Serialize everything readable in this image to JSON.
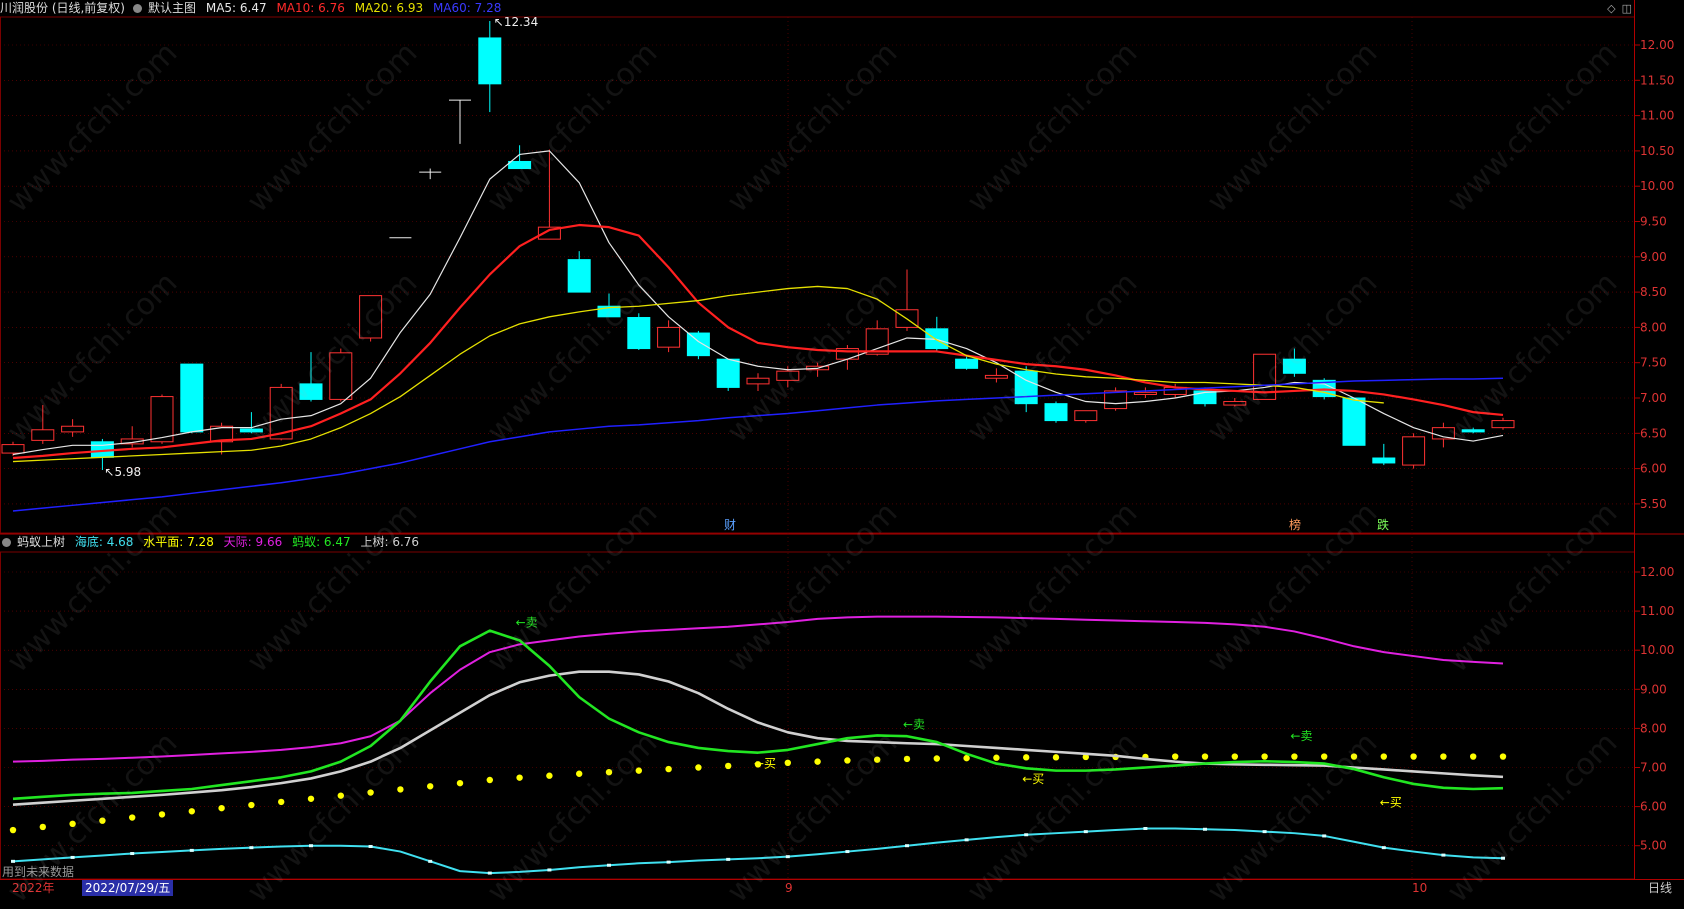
{
  "top_pane": {
    "stock": "川润股份 (日线,前复权)",
    "preset": "默认主图",
    "ma5": "MA5: 6.47",
    "ma10": "MA10: 6.76",
    "ma20": "MA20: 6.93",
    "ma60": "MA60: 7.28",
    "high_label": "12.34",
    "low_label": "5.98",
    "events": [
      "财",
      "榜",
      "跌"
    ],
    "y_ticks": [
      "12.00",
      "11.50",
      "11.00",
      "10.50",
      "10.00",
      "9.50",
      "9.00",
      "8.50",
      "8.00",
      "7.50",
      "7.00",
      "6.50",
      "6.00",
      "5.50"
    ]
  },
  "bottom_pane": {
    "indicator": "蚂蚁上树",
    "haidi": "海底: 4.68",
    "shuiping": "水平面: 7.28",
    "tianji": "天际: 9.66",
    "mayi": "蚂蚁: 6.47",
    "shangshu": "上树: 6.76",
    "signals": [
      "←卖",
      "←卖",
      "←卖",
      "←买",
      "←买",
      "←买"
    ],
    "y_ticks": [
      "12.00",
      "11.00",
      "10.00",
      "9.00",
      "8.00",
      "7.00",
      "6.00",
      "5.00"
    ],
    "note": "用到未来数据"
  },
  "footer": {
    "year": "2022年",
    "date": "2022/07/29/五",
    "m9": "9",
    "m10": "10",
    "period": "日线"
  },
  "watermark": "www.cfchi.com",
  "colors": {
    "up": "#ff3232",
    "down": "#00ffff",
    "ma5": "#e6e6e6",
    "ma10": "#ff2020",
    "ma20": "#e5e000",
    "ma60": "#2020ff",
    "haidi": "#40e0f0",
    "shuiping": "#ffff00",
    "tianji": "#e020e0",
    "mayi": "#22e622",
    "shangshu": "#d0d0d0",
    "grid": "#7a0000"
  },
  "chart_data": [
    {
      "type": "candlestick",
      "title": "川润股份 (日线,前复权)",
      "candles": [
        {
          "o": 6.22,
          "c": 6.34,
          "h": 6.38,
          "l": 6.18
        },
        {
          "o": 6.4,
          "c": 6.55,
          "h": 6.9,
          "l": 6.35
        },
        {
          "o": 6.52,
          "c": 6.6,
          "h": 6.7,
          "l": 6.45
        },
        {
          "o": 6.38,
          "c": 6.16,
          "h": 6.42,
          "l": 5.98
        },
        {
          "o": 6.35,
          "c": 6.42,
          "h": 6.6,
          "l": 6.3
        },
        {
          "o": 6.38,
          "c": 7.02,
          "h": 7.05,
          "l": 6.35
        },
        {
          "o": 7.48,
          "c": 6.52,
          "h": 7.48,
          "l": 6.5
        },
        {
          "o": 6.38,
          "c": 6.6,
          "h": 6.65,
          "l": 6.2
        },
        {
          "o": 6.56,
          "c": 6.52,
          "h": 6.8,
          "l": 6.5
        },
        {
          "o": 6.42,
          "c": 7.15,
          "h": 7.2,
          "l": 6.4
        },
        {
          "o": 7.2,
          "c": 6.98,
          "h": 7.65,
          "l": 6.95
        },
        {
          "o": 6.98,
          "c": 7.64,
          "h": 7.7,
          "l": 6.95
        },
        {
          "o": 7.85,
          "c": 8.45,
          "h": 8.45,
          "l": 7.8
        },
        {
          "o": 9.27,
          "c": 9.27,
          "h": 9.27,
          "l": 9.27
        },
        {
          "o": 10.2,
          "c": 10.2,
          "h": 10.25,
          "l": 10.1
        },
        {
          "o": 11.22,
          "c": 11.22,
          "h": 11.22,
          "l": 10.6
        },
        {
          "o": 12.1,
          "c": 11.45,
          "h": 12.34,
          "l": 11.05
        },
        {
          "o": 10.35,
          "c": 10.25,
          "h": 10.58,
          "l": 10.25
        },
        {
          "o": 9.25,
          "c": 9.42,
          "h": 10.52,
          "l": 9.25
        },
        {
          "o": 8.96,
          "c": 8.5,
          "h": 9.08,
          "l": 8.5
        },
        {
          "o": 8.3,
          "c": 8.15,
          "h": 8.48,
          "l": 8.15
        },
        {
          "o": 8.14,
          "c": 7.7,
          "h": 8.2,
          "l": 7.68
        },
        {
          "o": 7.72,
          "c": 8.0,
          "h": 8.1,
          "l": 7.65
        },
        {
          "o": 7.92,
          "c": 7.6,
          "h": 7.95,
          "l": 7.55
        },
        {
          "o": 7.55,
          "c": 7.15,
          "h": 7.55,
          "l": 7.1
        },
        {
          "o": 7.2,
          "c": 7.28,
          "h": 7.35,
          "l": 7.1
        },
        {
          "o": 7.25,
          "c": 7.38,
          "h": 7.45,
          "l": 7.15
        },
        {
          "o": 7.4,
          "c": 7.45,
          "h": 7.5,
          "l": 7.3
        },
        {
          "o": 7.55,
          "c": 7.7,
          "h": 7.75,
          "l": 7.4
        },
        {
          "o": 7.62,
          "c": 7.98,
          "h": 8.1,
          "l": 7.6
        },
        {
          "o": 8.0,
          "c": 8.25,
          "h": 8.82,
          "l": 7.95
        },
        {
          "o": 7.98,
          "c": 7.7,
          "h": 8.15,
          "l": 7.65
        },
        {
          "o": 7.55,
          "c": 7.42,
          "h": 7.6,
          "l": 7.4
        },
        {
          "o": 7.28,
          "c": 7.32,
          "h": 7.42,
          "l": 7.22
        },
        {
          "o": 7.38,
          "c": 6.92,
          "h": 7.45,
          "l": 6.8
        },
        {
          "o": 6.92,
          "c": 6.68,
          "h": 6.95,
          "l": 6.65
        },
        {
          "o": 6.68,
          "c": 6.82,
          "h": 6.82,
          "l": 6.65
        },
        {
          "o": 6.85,
          "c": 7.1,
          "h": 7.15,
          "l": 6.82
        },
        {
          "o": 7.05,
          "c": 7.08,
          "h": 7.15,
          "l": 7.0
        },
        {
          "o": 7.05,
          "c": 7.15,
          "h": 7.2,
          "l": 7.0
        },
        {
          "o": 7.1,
          "c": 6.92,
          "h": 7.15,
          "l": 6.88
        },
        {
          "o": 6.9,
          "c": 6.95,
          "h": 7.0,
          "l": 6.88
        },
        {
          "o": 6.98,
          "c": 7.62,
          "h": 7.62,
          "l": 6.98
        },
        {
          "o": 7.55,
          "c": 7.35,
          "h": 7.7,
          "l": 7.3
        },
        {
          "o": 7.25,
          "c": 7.02,
          "h": 7.28,
          "l": 6.98
        },
        {
          "o": 7.0,
          "c": 6.33,
          "h": 7.0,
          "l": 6.33
        },
        {
          "o": 6.15,
          "c": 6.08,
          "h": 6.35,
          "l": 6.05
        },
        {
          "o": 6.05,
          "c": 6.45,
          "h": 6.5,
          "l": 6.0
        },
        {
          "o": 6.42,
          "c": 6.58,
          "h": 6.65,
          "l": 6.3
        },
        {
          "o": 6.55,
          "c": 6.52,
          "h": 6.58,
          "l": 6.5
        },
        {
          "o": 6.58,
          "c": 6.68,
          "h": 6.72,
          "l": 6.55
        }
      ],
      "series": [
        {
          "name": "MA5",
          "values": [
            6.2,
            6.27,
            6.33,
            6.33,
            6.37,
            6.44,
            6.52,
            6.58,
            6.58,
            6.7,
            6.75,
            6.92,
            7.28,
            7.93,
            8.47,
            9.27,
            10.1,
            10.45,
            10.5,
            10.05,
            9.2,
            8.6,
            8.15,
            7.8,
            7.55,
            7.45,
            7.4,
            7.42,
            7.55,
            7.7,
            7.85,
            7.83,
            7.7,
            7.5,
            7.25,
            7.08,
            6.95,
            6.92,
            6.95,
            7.0,
            7.08,
            7.1,
            7.15,
            7.22,
            7.2,
            7.0,
            6.78,
            6.58,
            6.45,
            6.39,
            6.47
          ]
        },
        {
          "name": "MA10",
          "values": [
            6.15,
            6.18,
            6.22,
            6.25,
            6.28,
            6.3,
            6.35,
            6.4,
            6.42,
            6.5,
            6.6,
            6.78,
            6.98,
            7.35,
            7.78,
            8.28,
            8.75,
            9.15,
            9.38,
            9.45,
            9.42,
            9.3,
            8.85,
            8.35,
            8.0,
            7.78,
            7.72,
            7.68,
            7.66,
            7.66,
            7.66,
            7.66,
            7.6,
            7.54,
            7.48,
            7.45,
            7.4,
            7.32,
            7.22,
            7.15,
            7.12,
            7.1,
            7.08,
            7.1,
            7.12,
            7.1,
            7.05,
            6.98,
            6.9,
            6.8,
            6.76
          ]
        },
        {
          "name": "MA20",
          "values": [
            6.1,
            6.12,
            6.14,
            6.16,
            6.18,
            6.2,
            6.22,
            6.24,
            6.26,
            6.32,
            6.42,
            6.58,
            6.78,
            7.02,
            7.32,
            7.62,
            7.88,
            8.05,
            8.15,
            8.22,
            8.28,
            8.3,
            8.34,
            8.38,
            8.45,
            8.5,
            8.55,
            8.58,
            8.55,
            8.4,
            8.12,
            7.82,
            7.6,
            7.48,
            7.4,
            7.34,
            7.3,
            7.28,
            7.25,
            7.22,
            7.22,
            7.2,
            7.18,
            7.15,
            7.08,
            6.97,
            6.93
          ]
        },
        {
          "name": "MA60",
          "values": [
            5.4,
            5.44,
            5.48,
            5.52,
            5.56,
            5.6,
            5.65,
            5.7,
            5.75,
            5.8,
            5.86,
            5.92,
            6.0,
            6.08,
            6.18,
            6.28,
            6.38,
            6.45,
            6.52,
            6.56,
            6.6,
            6.62,
            6.65,
            6.68,
            6.72,
            6.75,
            6.78,
            6.82,
            6.86,
            6.9,
            6.93,
            6.96,
            6.98,
            7.0,
            7.02,
            7.04,
            7.06,
            7.08,
            7.1,
            7.12,
            7.14,
            7.16,
            7.18,
            7.2,
            7.22,
            7.24,
            7.25,
            7.26,
            7.27,
            7.27,
            7.28
          ]
        }
      ]
    },
    {
      "type": "line",
      "title": "蚂蚁上树",
      "series": [
        {
          "name": "海底",
          "values": [
            4.6,
            4.65,
            4.7,
            4.75,
            4.8,
            4.84,
            4.88,
            4.92,
            4.95,
            4.98,
            5.0,
            5.0,
            4.98,
            4.85,
            4.6,
            4.35,
            4.3,
            4.33,
            4.38,
            4.45,
            4.5,
            4.55,
            4.58,
            4.62,
            4.65,
            4.68,
            4.72,
            4.78,
            4.85,
            4.92,
            5.0,
            5.08,
            5.15,
            5.22,
            5.28,
            5.32,
            5.36,
            5.4,
            5.44,
            5.44,
            5.42,
            5.4,
            5.36,
            5.32,
            5.25,
            5.1,
            4.95,
            4.85,
            4.76,
            4.7,
            4.68
          ]
        },
        {
          "name": "水平面",
          "values": [
            5.4,
            5.48,
            5.56,
            5.64,
            5.72,
            5.8,
            5.88,
            5.96,
            6.04,
            6.12,
            6.2,
            6.28,
            6.36,
            6.44,
            6.52,
            6.6,
            6.68,
            6.74,
            6.79,
            6.84,
            6.88,
            6.92,
            6.96,
            7.0,
            7.04,
            7.08,
            7.12,
            7.15,
            7.18,
            7.2,
            7.22,
            7.23,
            7.24,
            7.25,
            7.26,
            7.26,
            7.27,
            7.27,
            7.27,
            7.28,
            7.28,
            7.28,
            7.28,
            7.28,
            7.28,
            7.28,
            7.28,
            7.28,
            7.28,
            7.28,
            7.28
          ]
        },
        {
          "name": "天际",
          "values": [
            7.15,
            7.17,
            7.2,
            7.22,
            7.25,
            7.28,
            7.32,
            7.36,
            7.4,
            7.45,
            7.52,
            7.62,
            7.8,
            8.2,
            8.9,
            9.5,
            9.95,
            10.15,
            10.25,
            10.35,
            10.42,
            10.48,
            10.52,
            10.56,
            10.6,
            10.66,
            10.72,
            10.8,
            10.84,
            10.86,
            10.86,
            10.86,
            10.85,
            10.84,
            10.82,
            10.8,
            10.78,
            10.76,
            10.74,
            10.72,
            10.7,
            10.66,
            10.6,
            10.48,
            10.3,
            10.1,
            9.95,
            9.85,
            9.75,
            9.7,
            9.66
          ]
        },
        {
          "name": "蚂蚁",
          "values": [
            6.2,
            6.25,
            6.3,
            6.33,
            6.35,
            6.4,
            6.45,
            6.55,
            6.65,
            6.75,
            6.9,
            7.15,
            7.55,
            8.2,
            9.2,
            10.1,
            10.5,
            10.25,
            9.6,
            8.8,
            8.25,
            7.9,
            7.65,
            7.5,
            7.42,
            7.38,
            7.45,
            7.6,
            7.75,
            7.82,
            7.8,
            7.65,
            7.35,
            7.1,
            6.98,
            6.92,
            6.92,
            6.95,
            7.0,
            7.05,
            7.1,
            7.14,
            7.16,
            7.14,
            7.1,
            6.96,
            6.75,
            6.58,
            6.48,
            6.45,
            6.47
          ]
        },
        {
          "name": "上树",
          "values": [
            6.05,
            6.1,
            6.15,
            6.2,
            6.25,
            6.3,
            6.36,
            6.42,
            6.5,
            6.6,
            6.72,
            6.9,
            7.15,
            7.5,
            7.95,
            8.4,
            8.85,
            9.18,
            9.35,
            9.45,
            9.45,
            9.38,
            9.2,
            8.9,
            8.5,
            8.15,
            7.9,
            7.75,
            7.68,
            7.65,
            7.62,
            7.6,
            7.55,
            7.5,
            7.45,
            7.4,
            7.35,
            7.3,
            7.22,
            7.15,
            7.1,
            7.08,
            7.07,
            7.06,
            7.05,
            7.0,
            6.95,
            6.9,
            6.85,
            6.8,
            6.76
          ]
        }
      ]
    }
  ]
}
